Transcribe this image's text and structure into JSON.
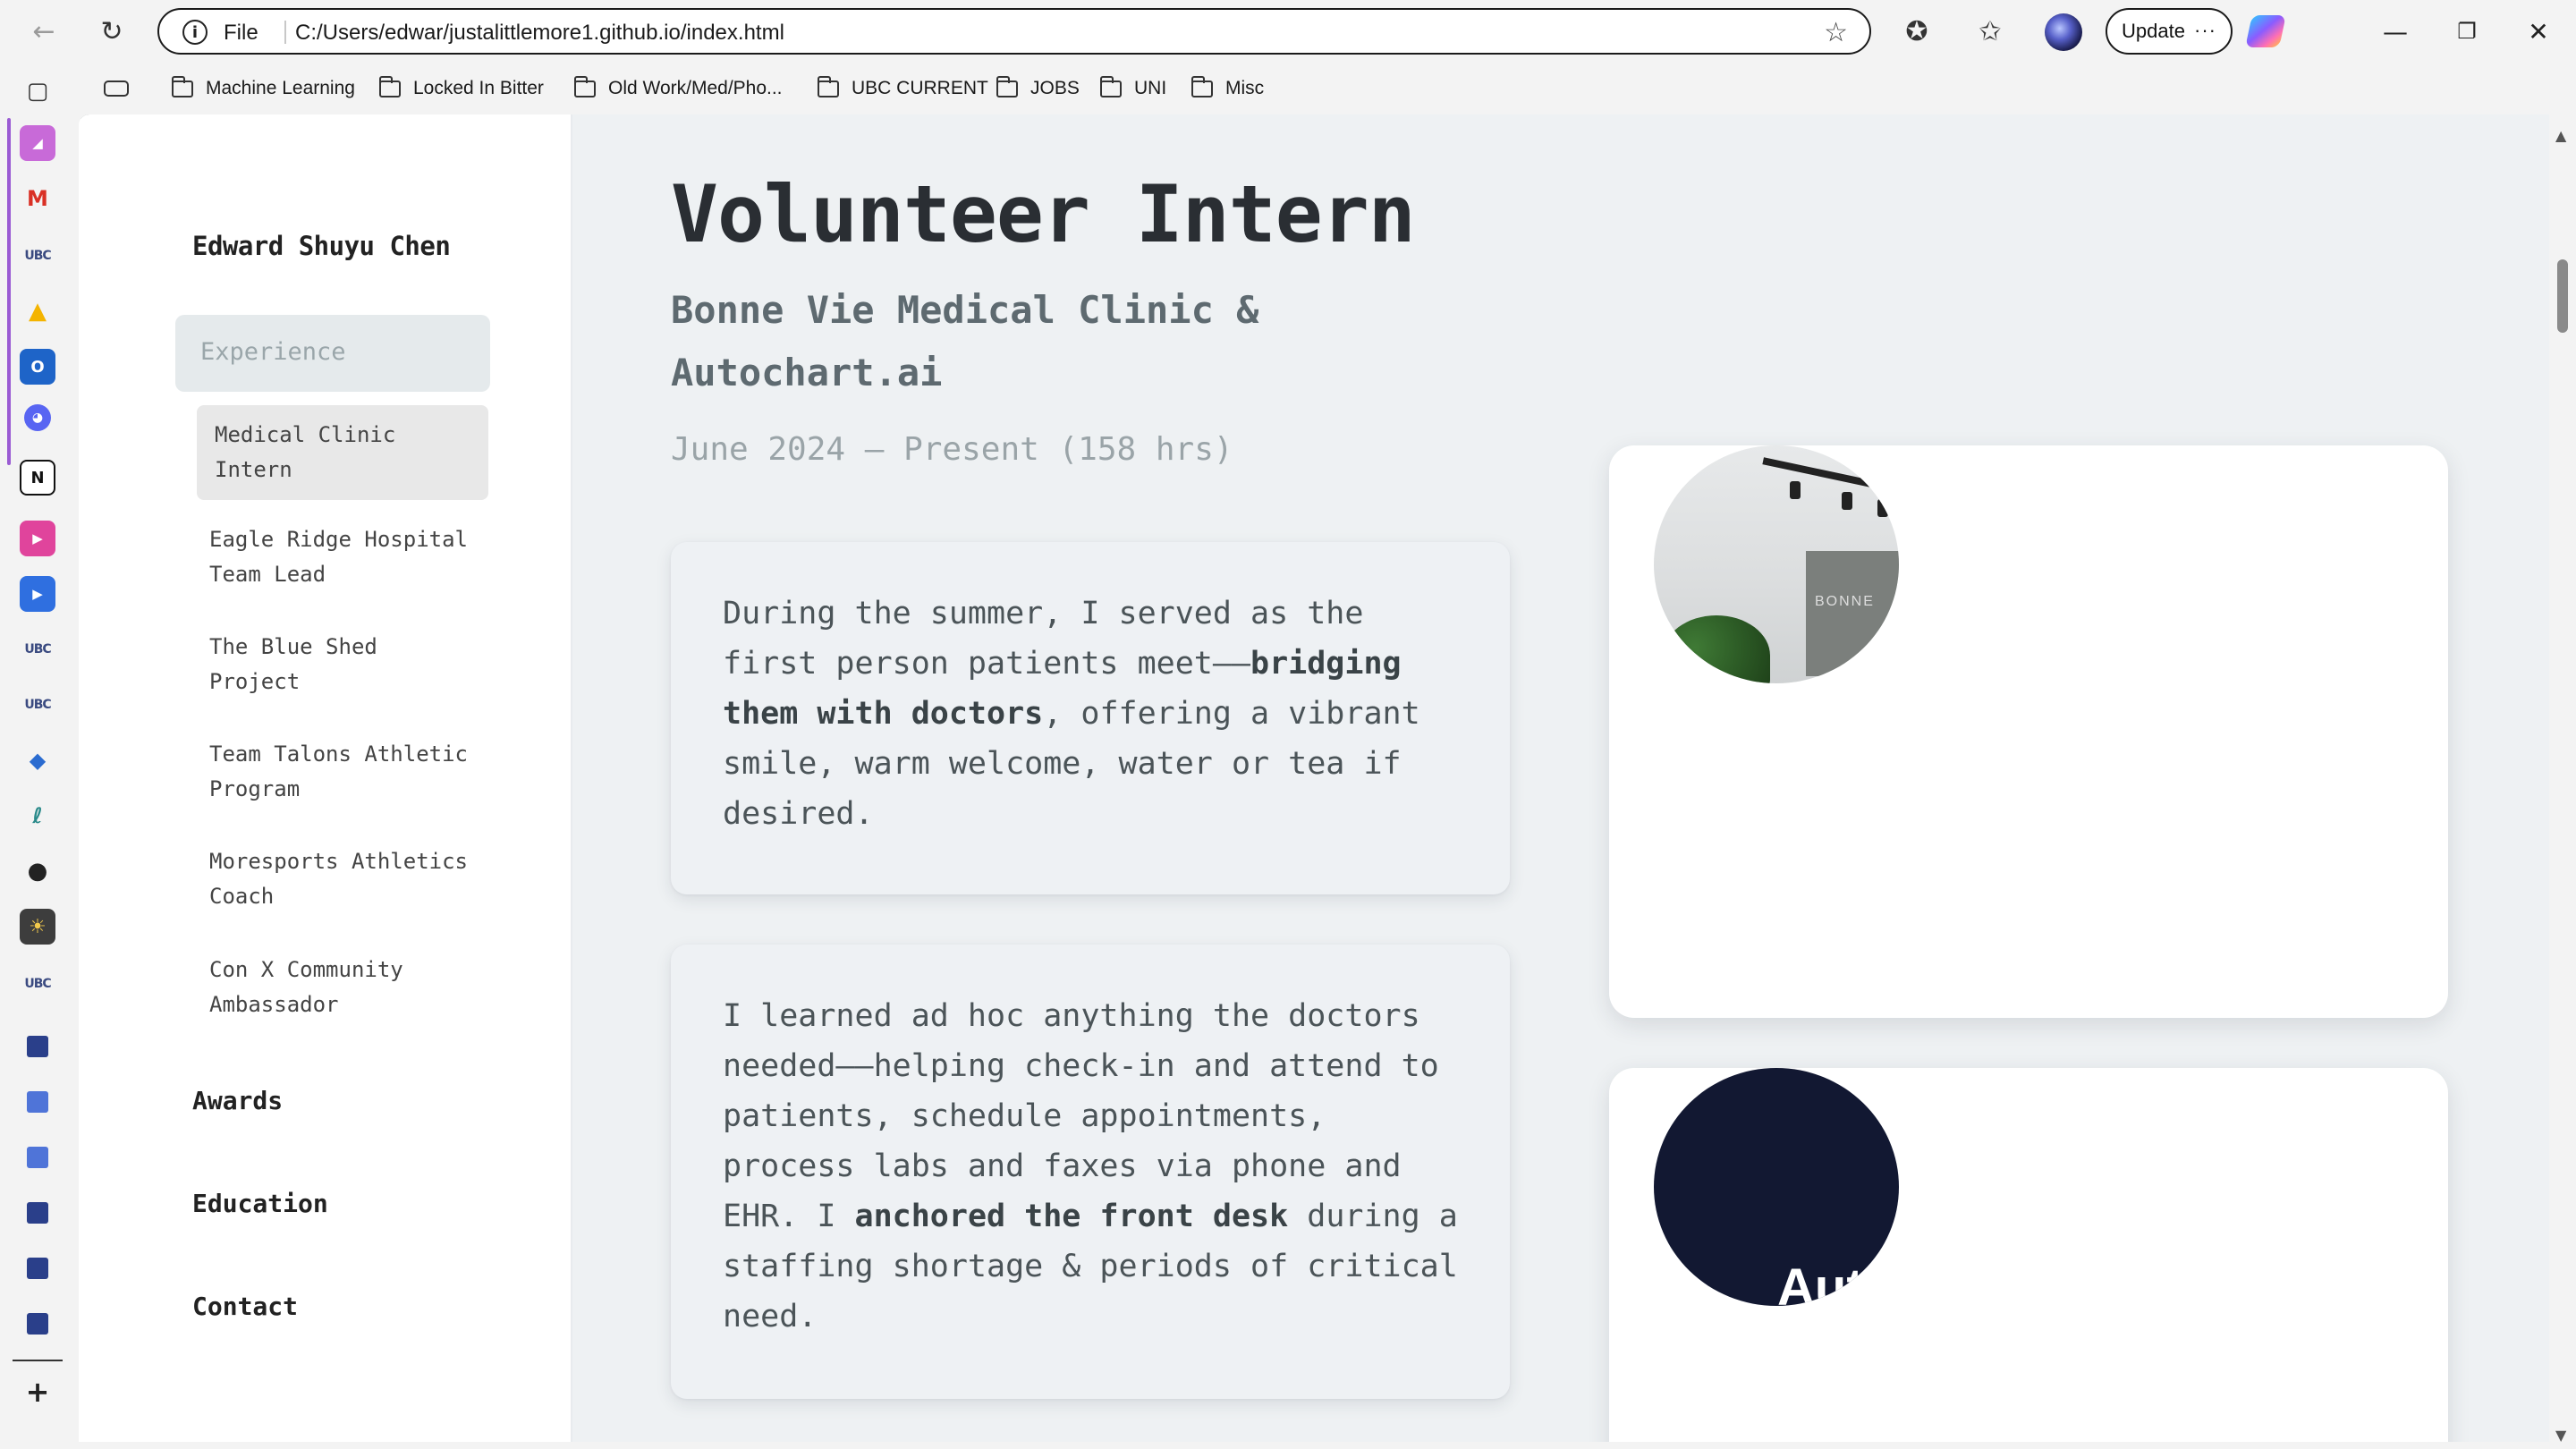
{
  "browser": {
    "scheme": "File",
    "url": "C:/Users/edwar/justalittlemore1.github.io/index.html",
    "update_label": "Update",
    "bookmarks": [
      "Machine Learning",
      "Locked In Bitter",
      "Old Work/Med/Pho...",
      "UBC CURRENT",
      "JOBS",
      "UNI",
      "Misc"
    ],
    "sidebar_labels": [
      "UBC",
      "UBC",
      "UBC",
      "UBC"
    ]
  },
  "nav": {
    "site_name": "Edward Shuyu Chen",
    "experience_label": "Experience",
    "experience_items": [
      "Medical Clinic Intern",
      "Eagle Ridge Hospital Team Lead",
      "The Blue Shed Project",
      "Team Talons Athletic Program",
      "Moresports Athletics Coach",
      "Con X Community Ambassador"
    ],
    "sections": [
      "Awards",
      "Education",
      "Contact"
    ]
  },
  "main": {
    "title": "Volunteer Intern",
    "organization": "Bonne Vie Medical Clinic & Autochart.ai",
    "dates": "June 2024 — Present (158 hrs)",
    "card1": {
      "before": "During the summer, I served as the first person patients meet——",
      "bold": "bridging them with doctors",
      "after": ", offering a vibrant smile, warm welcome, water or tea if desired."
    },
    "card2": {
      "before": "I learned ad hoc anything the doctors needed——helping check-in and attend to patients, schedule appointments, process labs and faxes via phone and EHR. I ",
      "bold": "anchored the front desk",
      "after": " during a staffing shortage & periods of critical need."
    },
    "photo_sign_text": "BONNE",
    "logo_text": "Aut"
  },
  "colors": {
    "accent_nav": "#e5eaec",
    "main_bg": "#eef1f3",
    "logo_bg": "#121832"
  }
}
